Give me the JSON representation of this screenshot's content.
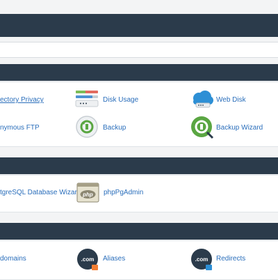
{
  "files": {
    "items": [
      {
        "label": "ectory Privacy",
        "icon": "lock-folder-icon"
      },
      {
        "label": "Disk Usage",
        "icon": "disk-usage-icon"
      },
      {
        "label": "Web Disk",
        "icon": "cloud-drive-icon"
      },
      {
        "label": "nymous FTP",
        "icon": "ftp-icon"
      },
      {
        "label": "Backup",
        "icon": "backup-icon"
      },
      {
        "label": "Backup Wizard",
        "icon": "backup-wizard-icon"
      }
    ]
  },
  "databases": {
    "items": [
      {
        "label": "tgreSQL Database Wizard",
        "icon": "postgresql-wizard-icon"
      },
      {
        "label": "phpPgAdmin",
        "icon": "php-icon",
        "icon_text": "php"
      }
    ]
  },
  "domains": {
    "items": [
      {
        "label": "domains",
        "icon": "subdomains-icon"
      },
      {
        "label": "Aliases",
        "icon": "dotcom-aliases-icon",
        "icon_text": ".com"
      },
      {
        "label": "Redirects",
        "icon": "dotcom-redirects-icon",
        "icon_text": ".com"
      }
    ]
  },
  "colors": {
    "header": "#2b3b4b",
    "link": "#2a6ebb",
    "backup_green": "#5aa642",
    "cloud_blue": "#2d8fd5",
    "badge_orange": "#f27d32"
  }
}
